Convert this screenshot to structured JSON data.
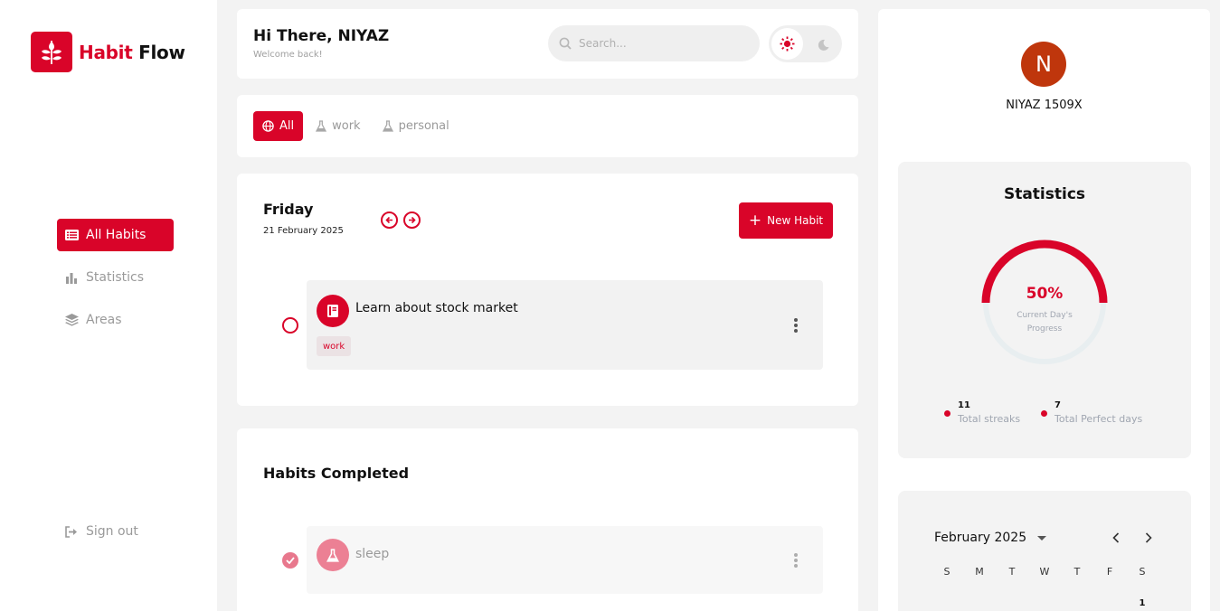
{
  "app": {
    "name_part1": "Habit",
    "name_part2": "Flow"
  },
  "sidebar": {
    "items": [
      {
        "label": "All Habits",
        "active": true,
        "icon": "list-icon"
      },
      {
        "label": "Statistics",
        "active": false,
        "icon": "bar-chart-icon"
      },
      {
        "label": "Areas",
        "active": false,
        "icon": "layers-icon"
      }
    ],
    "signout_label": "Sign out"
  },
  "header": {
    "greeting": "Hi There, NIYAZ",
    "subtitle": "Welcome back!",
    "search_placeholder": "Search...",
    "theme": {
      "light_icon": "sun-icon",
      "dark_icon": "moon-icon",
      "active": "light"
    }
  },
  "filters": [
    {
      "label": "All",
      "active": true,
      "icon": "globe-icon"
    },
    {
      "label": "work",
      "active": false,
      "icon": "flask-icon"
    },
    {
      "label": "personal",
      "active": false,
      "icon": "flask-icon"
    }
  ],
  "day": {
    "name": "Friday",
    "date": "21 February 2025",
    "new_habit_label": "New Habit"
  },
  "habits": [
    {
      "name": "Learn about stock market",
      "tag": "work",
      "icon": "book-icon",
      "done": false
    }
  ],
  "completed": {
    "title": "Habits Completed",
    "items": [
      {
        "name": "sleep",
        "icon": "flask-icon",
        "done": true
      }
    ]
  },
  "profile": {
    "initial": "N",
    "username": "NIYAZ 1509X"
  },
  "stats": {
    "title": "Statistics",
    "progress_percent": 50,
    "progress_text": "50%",
    "progress_label": "Current Day's Progress",
    "streaks_value": "11",
    "streaks_label": "Total streaks",
    "perfect_value": "7",
    "perfect_label": "Total Perfect days"
  },
  "calendar": {
    "month_label": "February 2025",
    "weekdays": [
      "S",
      "M",
      "T",
      "W",
      "T",
      "F",
      "S"
    ],
    "first_day": "1"
  },
  "colors": {
    "accent": "#d90429",
    "avatar": "#bf360c",
    "muted": "#9a9a9a"
  }
}
